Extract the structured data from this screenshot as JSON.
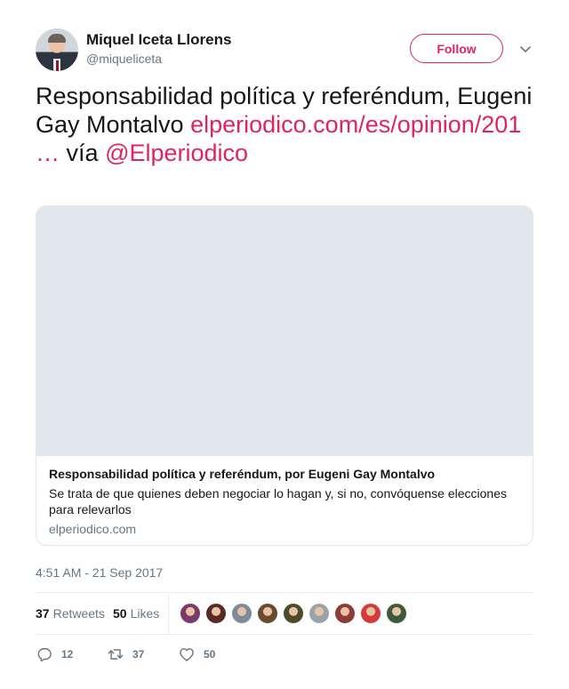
{
  "user": {
    "name": "Miquel Iceta Llorens",
    "handle": "@miqueliceta"
  },
  "header": {
    "follow_label": "Follow"
  },
  "tweet": {
    "text_plain": "Responsabilidad política y referéndum, Eugeni Gay Montalvo",
    "link_text": "elperiodico.com/es/opinion/201",
    "ellipsis": "…",
    "via_text": "vía",
    "mention": "@Elperiodico"
  },
  "card": {
    "title": "Responsabilidad política y referéndum, por Eugeni Gay Montalvo",
    "description": "Se trata de que quienes deben negociar lo hagan y, si no, convóquense elecciones para relevarlos",
    "domain": "elperiodico.com"
  },
  "timestamp": "4:51 AM - 21 Sep 2017",
  "stats": {
    "retweets_count": "37",
    "retweets_label": "Retweets",
    "likes_count": "50",
    "likes_label": "Likes"
  },
  "likers": [
    {
      "icon": "liker-avatar",
      "color": "#7a3b6a"
    },
    {
      "icon": "liker-avatar",
      "color": "#5a2a22"
    },
    {
      "icon": "liker-avatar",
      "color": "#7f8b94"
    },
    {
      "icon": "liker-avatar",
      "color": "#6b4a2f"
    },
    {
      "icon": "liker-avatar",
      "color": "#4c4b2a"
    },
    {
      "icon": "liker-avatar",
      "color": "#9aa3a9"
    },
    {
      "icon": "liker-avatar",
      "color": "#8e3b38"
    },
    {
      "icon": "liker-avatar",
      "color": "#d63b3b"
    },
    {
      "icon": "liker-avatar",
      "color": "#3f5a3a"
    }
  ],
  "actions": {
    "reply_count": "12",
    "retweet_count": "37",
    "like_count": "50"
  },
  "colors": {
    "accent": "#e0245e",
    "muted": "#657786",
    "border": "#e1e8ed"
  },
  "icons": {
    "caret": "chevron-down-icon",
    "reply": "reply-icon",
    "retweet": "retweet-icon",
    "like": "heart-icon"
  }
}
